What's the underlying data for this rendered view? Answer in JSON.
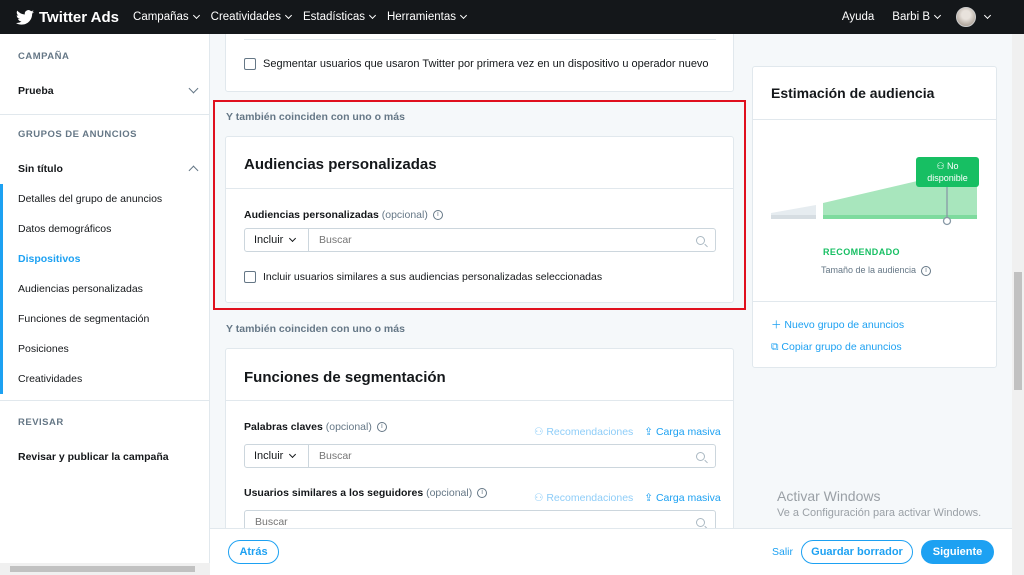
{
  "topbar": {
    "brand": "Twitter Ads",
    "nav": [
      "Campañas",
      "Creatividades",
      "Estadísticas",
      "Herramientas"
    ],
    "help": "Ayuda",
    "user": "Barbi B"
  },
  "sidebar": {
    "campaign_section": "CAMPAÑA",
    "campaign_name": "Prueba",
    "groups_section": "GRUPOS DE ANUNCIOS",
    "group_name": "Sin título",
    "items": [
      "Detalles del grupo de anuncios",
      "Datos demográficos",
      "Dispositivos",
      "Audiencias personalizadas",
      "Funciones de segmentación",
      "Posiciones",
      "Creatividades"
    ],
    "review_section": "REVISAR",
    "review_item": "Revisar y publicar la campaña"
  },
  "main": {
    "first_time_checkbox": "Segmentar usuarios que usaron Twitter por primera vez en un dispositivo u operador nuevo",
    "also_match_1": "Y también coinciden con uno o más",
    "custom_audiences": {
      "title": "Audiencias personalizadas",
      "field_label": "Audiencias personalizadas",
      "optional": "(opcional)",
      "include": "Incluir",
      "search_placeholder": "Buscar",
      "similar_checkbox": "Incluir usuarios similares a sus audiencias personalizadas seleccionadas"
    },
    "also_match_2": "Y también coinciden con uno o más",
    "targeting": {
      "title": "Funciones de segmentación",
      "keywords_label": "Palabras claves",
      "optional": "(opcional)",
      "recommendations": "Recomendaciones",
      "bulk_upload": "Carga masiva",
      "include": "Incluir",
      "search_placeholder": "Buscar",
      "followers_label": "Usuarios similares a los seguidores",
      "followers_placeholder": "Buscar"
    }
  },
  "audience_panel": {
    "title": "Estimación de audiencia",
    "badge_line1": "No",
    "badge_line2": "disponible",
    "recommended": "RECOMENDADO",
    "size_label": "Tamaño de la audiencia",
    "new_group": "Nuevo grupo de anuncios",
    "copy_group": "Copiar grupo de anuncios"
  },
  "watermark": {
    "line1": "Activar Windows",
    "line2": "Ve a Configuración para activar Windows."
  },
  "footer": {
    "back": "Atrás",
    "exit": "Salir",
    "save_draft": "Guardar borrador",
    "next": "Siguiente"
  },
  "colors": {
    "accent": "#1da1f2",
    "topbar": "#14171a",
    "highlight": "#e0101e",
    "green": "#17bf63"
  }
}
